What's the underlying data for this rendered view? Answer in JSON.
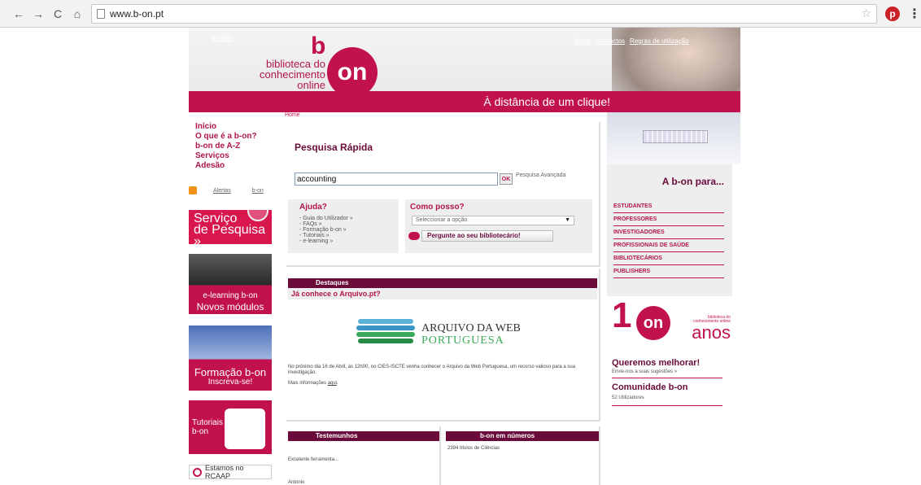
{
  "browser": {
    "url": "www.b-on.pt"
  },
  "header": {
    "english_link": "english",
    "brand_line1": "biblioteca do",
    "brand_line2": "conhecimento online",
    "logo_b": "b",
    "logo_on": "on",
    "toplinks": [
      "Mapa",
      "Contactos",
      "Regras de utilização"
    ],
    "slogan": "À distância de um clique!"
  },
  "breadcrumb": "Home",
  "leftnav": {
    "items": [
      "Início",
      "O que é a b-on?",
      "b-on de A-Z",
      "Serviços",
      "Adesão"
    ],
    "alerts": "Alertas",
    "alerts_bon": "b-on"
  },
  "promos": {
    "servico_line1": "Serviço",
    "servico_line2": "de Pesquisa »",
    "elearning_line1": "e-learning b-on",
    "elearning_line2": "Novos módulos",
    "formacao_line1": "Formação b-on",
    "formacao_line2": "Inscreva-se!",
    "tutoriais_line1": "Tutoriais",
    "tutoriais_line2": "b-on",
    "rcaap": "Estamos no RCAAP"
  },
  "search": {
    "title": "Pesquisa Rápida",
    "value": "accounting",
    "ok": "OK",
    "advanced": "Pesquisa Avançada"
  },
  "help": {
    "title": "Ajuda?",
    "items": [
      "- Guia do Utilizador »",
      "- FAQs »",
      "- Formação b-on »",
      "- Tutoriais »",
      "- e-learning »"
    ]
  },
  "como": {
    "title": "Como posso?",
    "select_value": "Seleccionar a opção",
    "ask": "Pergunte ao seu bibliotecário!"
  },
  "destaques": {
    "bar": "Destaques",
    "headline": "Já conhece o Arquivo.pt?",
    "logo_line1": "ARQUIVO DA WEB",
    "logo_line2": "PORTUGUESA",
    "paragraph": "No próximo dia 16 de Abril, às 12h00, no CIES-ISCTE venha conhecer o Arquivo da Web Portuguesa, um recurso valioso para a sua investigação.",
    "more_prefix": "Mais informações",
    "more_link": "aqui"
  },
  "testemunhos": {
    "bar": "Testemunhos",
    "quote": "Excelente ferramenta...",
    "author": "Antonio"
  },
  "numeros": {
    "bar": "b-on em números",
    "value": "2394 títulos de Ciências"
  },
  "right": {
    "heading": "A b-on para...",
    "audiences": [
      "ESTUDANTES",
      "PROFESSORES",
      "INVESTIGADORES",
      "PROFISSIONAIS DE SAÚDE",
      "BIBLIOTECÁRIOS",
      "PUBLISHERS"
    ],
    "anos_one": "1",
    "anos_on": "on",
    "anos_small1": "biblioteca do",
    "anos_small2": "conhecimento online",
    "anos_word": "anos",
    "queremos": "Queremos melhorar!",
    "queremos_sub": "Envie-nos a suas sugestões »",
    "comunidade": "Comunidade b-on",
    "comunidade_sub": "52 Utilizadores"
  }
}
